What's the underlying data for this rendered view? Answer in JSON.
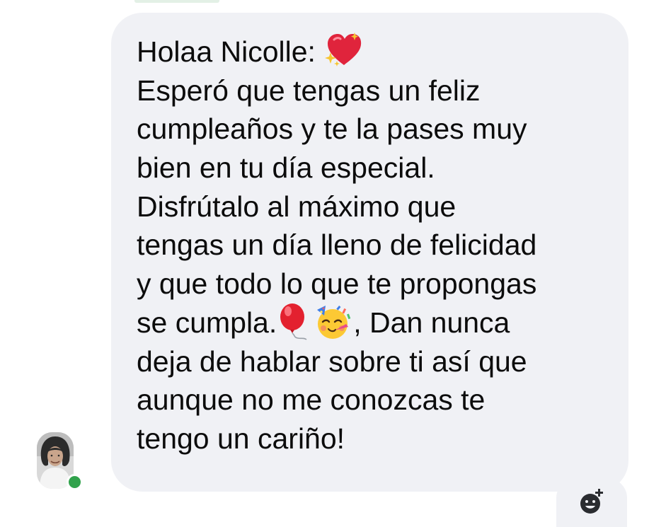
{
  "message": {
    "lines": [
      {
        "text": "Holaa  Nicolle: "
      },
      {
        "text": "Esperó que tengas un feliz"
      },
      {
        "text": "cumpleaños y te la pases muy"
      },
      {
        "text": "bien en tu día especial."
      },
      {
        "text": "Disfrútalo al máximo  que"
      },
      {
        "text": "tengas un día lleno de felicidad"
      },
      {
        "text": "y que todo lo que te propongas"
      },
      {
        "text": "se cumpla.",
        "after_emoji": ", Dan nunca"
      },
      {
        "text": "deja de hablar sobre ti así que"
      },
      {
        "text": "aunque no me conozcas te"
      },
      {
        "text": "tengo un cariño!"
      }
    ],
    "emojis": [
      "sparkling-heart",
      "balloon",
      "partying-face"
    ]
  },
  "colors": {
    "bubble_background": "#f0f1f5",
    "text": "#0c0c0c",
    "presence_online": "#31a24c",
    "react_icon": "#2a2c30"
  }
}
